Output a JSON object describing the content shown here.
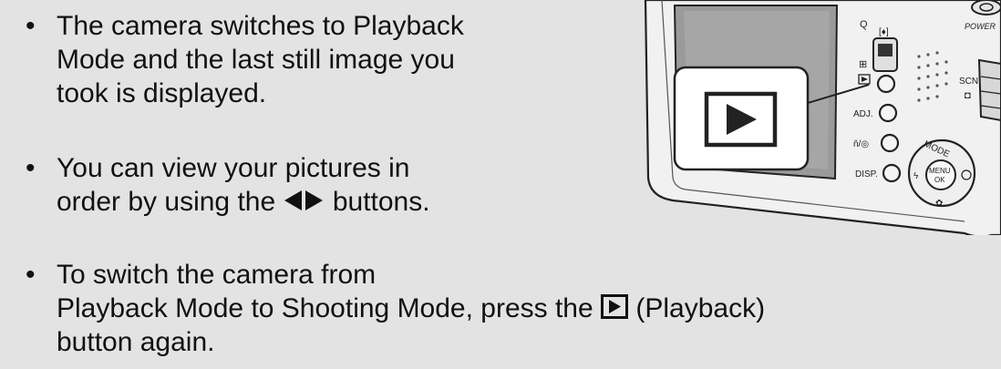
{
  "bullets": [
    {
      "marker": "•",
      "line1": "The camera switches to Playback",
      "line2": "Mode and the last still image you",
      "line3": "took is displayed."
    },
    {
      "marker": "•",
      "line1": "You can view your pictures in",
      "line2_before": "order by using the ",
      "line2_after": " buttons."
    },
    {
      "marker": "•",
      "line1": "To switch the camera from",
      "line2_before": "Playback Mode to Shooting Mode, press the ",
      "line2_after": " (Playback)",
      "line3": "button again."
    }
  ],
  "camera": {
    "power_label": "POWER",
    "adj_label": "ADJ.",
    "disp_label": "DISP.",
    "scn_label": "SCN",
    "mode_label": "MODE",
    "menu_label": "MENU",
    "ok_label": "OK",
    "delete_self_label": "ň/◎"
  },
  "icons": {
    "playback": "playback-icon",
    "left_right": "left-right-arrows-icon"
  }
}
